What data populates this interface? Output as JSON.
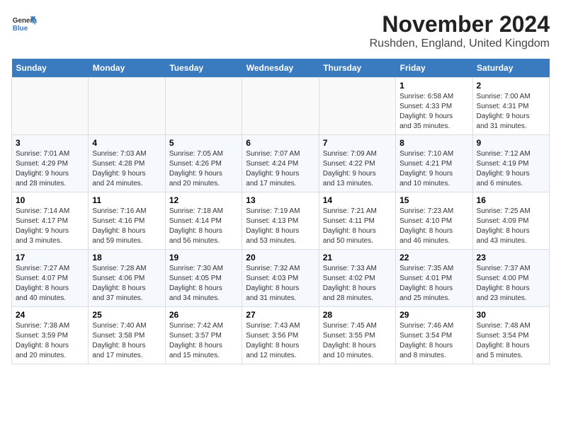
{
  "header": {
    "logo_line1": "General",
    "logo_line2": "Blue",
    "month_title": "November 2024",
    "location": "Rushden, England, United Kingdom"
  },
  "weekdays": [
    "Sunday",
    "Monday",
    "Tuesday",
    "Wednesday",
    "Thursday",
    "Friday",
    "Saturday"
  ],
  "weeks": [
    [
      {
        "day": "",
        "info": ""
      },
      {
        "day": "",
        "info": ""
      },
      {
        "day": "",
        "info": ""
      },
      {
        "day": "",
        "info": ""
      },
      {
        "day": "",
        "info": ""
      },
      {
        "day": "1",
        "info": "Sunrise: 6:58 AM\nSunset: 4:33 PM\nDaylight: 9 hours\nand 35 minutes."
      },
      {
        "day": "2",
        "info": "Sunrise: 7:00 AM\nSunset: 4:31 PM\nDaylight: 9 hours\nand 31 minutes."
      }
    ],
    [
      {
        "day": "3",
        "info": "Sunrise: 7:01 AM\nSunset: 4:29 PM\nDaylight: 9 hours\nand 28 minutes."
      },
      {
        "day": "4",
        "info": "Sunrise: 7:03 AM\nSunset: 4:28 PM\nDaylight: 9 hours\nand 24 minutes."
      },
      {
        "day": "5",
        "info": "Sunrise: 7:05 AM\nSunset: 4:26 PM\nDaylight: 9 hours\nand 20 minutes."
      },
      {
        "day": "6",
        "info": "Sunrise: 7:07 AM\nSunset: 4:24 PM\nDaylight: 9 hours\nand 17 minutes."
      },
      {
        "day": "7",
        "info": "Sunrise: 7:09 AM\nSunset: 4:22 PM\nDaylight: 9 hours\nand 13 minutes."
      },
      {
        "day": "8",
        "info": "Sunrise: 7:10 AM\nSunset: 4:21 PM\nDaylight: 9 hours\nand 10 minutes."
      },
      {
        "day": "9",
        "info": "Sunrise: 7:12 AM\nSunset: 4:19 PM\nDaylight: 9 hours\nand 6 minutes."
      }
    ],
    [
      {
        "day": "10",
        "info": "Sunrise: 7:14 AM\nSunset: 4:17 PM\nDaylight: 9 hours\nand 3 minutes."
      },
      {
        "day": "11",
        "info": "Sunrise: 7:16 AM\nSunset: 4:16 PM\nDaylight: 8 hours\nand 59 minutes."
      },
      {
        "day": "12",
        "info": "Sunrise: 7:18 AM\nSunset: 4:14 PM\nDaylight: 8 hours\nand 56 minutes."
      },
      {
        "day": "13",
        "info": "Sunrise: 7:19 AM\nSunset: 4:13 PM\nDaylight: 8 hours\nand 53 minutes."
      },
      {
        "day": "14",
        "info": "Sunrise: 7:21 AM\nSunset: 4:11 PM\nDaylight: 8 hours\nand 50 minutes."
      },
      {
        "day": "15",
        "info": "Sunrise: 7:23 AM\nSunset: 4:10 PM\nDaylight: 8 hours\nand 46 minutes."
      },
      {
        "day": "16",
        "info": "Sunrise: 7:25 AM\nSunset: 4:09 PM\nDaylight: 8 hours\nand 43 minutes."
      }
    ],
    [
      {
        "day": "17",
        "info": "Sunrise: 7:27 AM\nSunset: 4:07 PM\nDaylight: 8 hours\nand 40 minutes."
      },
      {
        "day": "18",
        "info": "Sunrise: 7:28 AM\nSunset: 4:06 PM\nDaylight: 8 hours\nand 37 minutes."
      },
      {
        "day": "19",
        "info": "Sunrise: 7:30 AM\nSunset: 4:05 PM\nDaylight: 8 hours\nand 34 minutes."
      },
      {
        "day": "20",
        "info": "Sunrise: 7:32 AM\nSunset: 4:03 PM\nDaylight: 8 hours\nand 31 minutes."
      },
      {
        "day": "21",
        "info": "Sunrise: 7:33 AM\nSunset: 4:02 PM\nDaylight: 8 hours\nand 28 minutes."
      },
      {
        "day": "22",
        "info": "Sunrise: 7:35 AM\nSunset: 4:01 PM\nDaylight: 8 hours\nand 25 minutes."
      },
      {
        "day": "23",
        "info": "Sunrise: 7:37 AM\nSunset: 4:00 PM\nDaylight: 8 hours\nand 23 minutes."
      }
    ],
    [
      {
        "day": "24",
        "info": "Sunrise: 7:38 AM\nSunset: 3:59 PM\nDaylight: 8 hours\nand 20 minutes."
      },
      {
        "day": "25",
        "info": "Sunrise: 7:40 AM\nSunset: 3:58 PM\nDaylight: 8 hours\nand 17 minutes."
      },
      {
        "day": "26",
        "info": "Sunrise: 7:42 AM\nSunset: 3:57 PM\nDaylight: 8 hours\nand 15 minutes."
      },
      {
        "day": "27",
        "info": "Sunrise: 7:43 AM\nSunset: 3:56 PM\nDaylight: 8 hours\nand 12 minutes."
      },
      {
        "day": "28",
        "info": "Sunrise: 7:45 AM\nSunset: 3:55 PM\nDaylight: 8 hours\nand 10 minutes."
      },
      {
        "day": "29",
        "info": "Sunrise: 7:46 AM\nSunset: 3:54 PM\nDaylight: 8 hours\nand 8 minutes."
      },
      {
        "day": "30",
        "info": "Sunrise: 7:48 AM\nSunset: 3:54 PM\nDaylight: 8 hours\nand 5 minutes."
      }
    ]
  ]
}
